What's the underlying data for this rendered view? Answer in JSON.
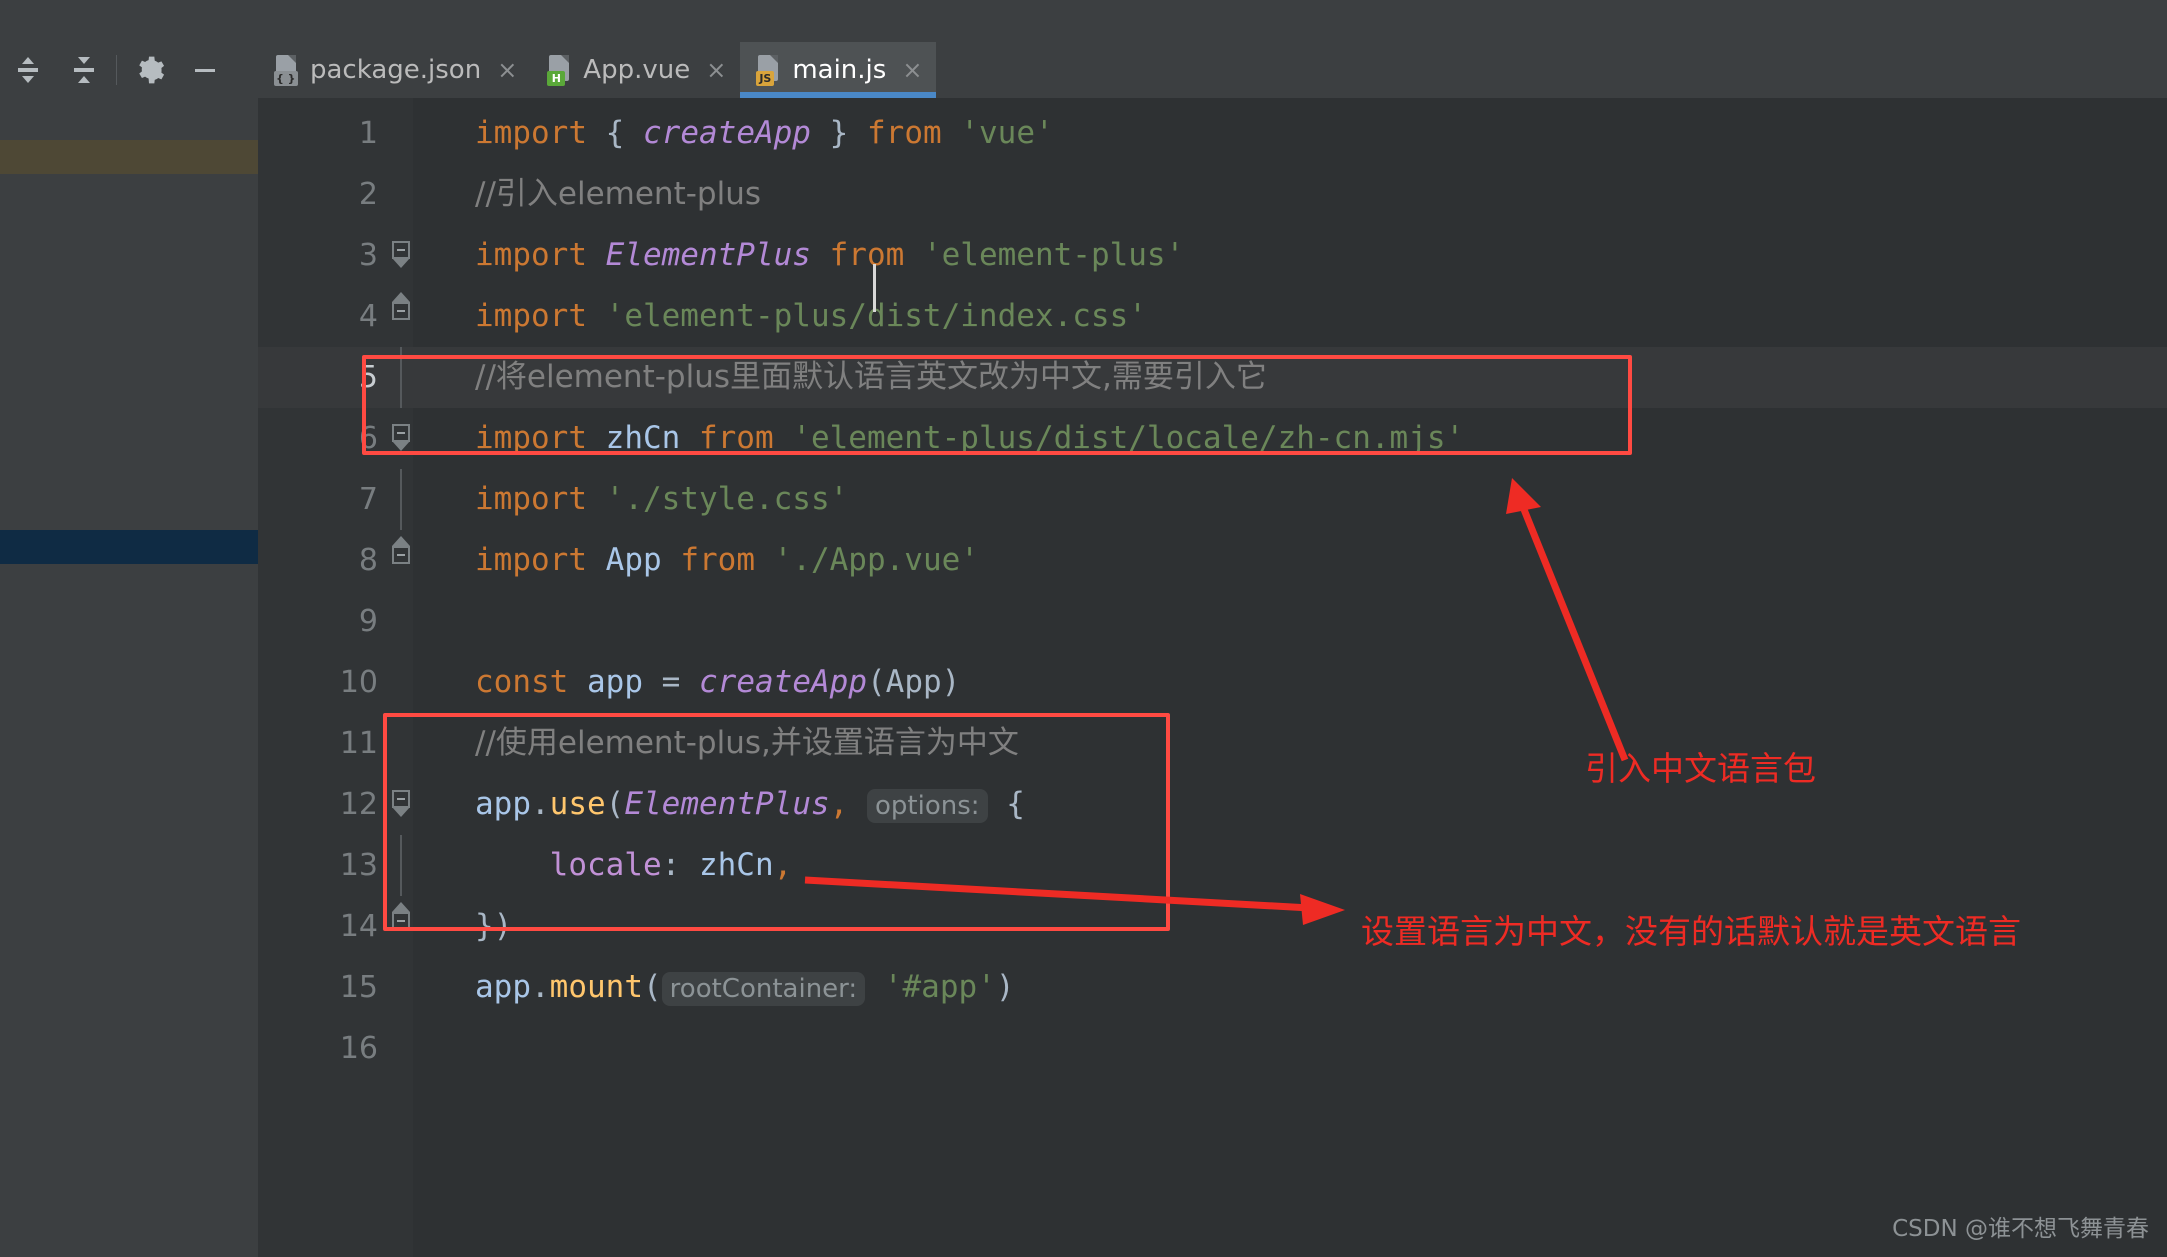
{
  "toolbar": {
    "buttons": [
      {
        "name": "expand-all-icon",
        "label": "Expand All"
      },
      {
        "name": "collapse-all-icon",
        "label": "Collapse All"
      },
      {
        "name": "settings-gear-icon",
        "label": "Settings"
      },
      {
        "name": "hide-icon",
        "label": "Hide"
      }
    ]
  },
  "tabs": [
    {
      "label": "package.json",
      "badge": "{ }",
      "badge_kind": "json",
      "active": false,
      "close": "×"
    },
    {
      "label": "App.vue",
      "badge": "H",
      "badge_kind": "html",
      "active": false,
      "close": "×"
    },
    {
      "label": "main.js",
      "badge": "JS",
      "badge_kind": "js",
      "active": true,
      "close": "×"
    }
  ],
  "editor": {
    "language": "javascript",
    "current_line": 5,
    "lines": [
      {
        "n": "1",
        "tokens": [
          {
            "t": "import",
            "c": "k"
          },
          {
            "t": " ",
            "c": "pun"
          },
          {
            "t": "{",
            "c": "pun"
          },
          {
            "t": " ",
            "c": "pun"
          },
          {
            "t": "createApp",
            "c": "fn"
          },
          {
            "t": " ",
            "c": "pun"
          },
          {
            "t": "}",
            "c": "pun"
          },
          {
            "t": " ",
            "c": "pun"
          },
          {
            "t": "from",
            "c": "k"
          },
          {
            "t": " ",
            "c": "pun"
          },
          {
            "t": "'vue'",
            "c": "str"
          }
        ]
      },
      {
        "n": "2",
        "tokens": [
          {
            "t": "//引入element-plus",
            "c": "cmt"
          }
        ]
      },
      {
        "n": "3",
        "tokens": [
          {
            "t": "import",
            "c": "k"
          },
          {
            "t": " ",
            "c": "pun"
          },
          {
            "t": "ElementPlus",
            "c": "cls"
          },
          {
            "t": " ",
            "c": "pun"
          },
          {
            "t": "from",
            "c": "k"
          },
          {
            "t": " ",
            "c": "pun"
          },
          {
            "t": "'element-plus'",
            "c": "str"
          }
        ]
      },
      {
        "n": "4",
        "tokens": [
          {
            "t": "import",
            "c": "k"
          },
          {
            "t": " ",
            "c": "pun"
          },
          {
            "t": "'element-plus/dist/index.css'",
            "c": "str"
          }
        ]
      },
      {
        "n": "5",
        "tokens": [
          {
            "t": "//将element-plus里面默认语言英文改为中文,需要引入它",
            "c": "cmt"
          }
        ]
      },
      {
        "n": "6",
        "tokens": [
          {
            "t": "import",
            "c": "k"
          },
          {
            "t": " ",
            "c": "pun"
          },
          {
            "t": "zhCn",
            "c": "id"
          },
          {
            "t": " ",
            "c": "pun"
          },
          {
            "t": "from",
            "c": "k"
          },
          {
            "t": " ",
            "c": "pun"
          },
          {
            "t": "'element-plus/dist/locale/zh-cn.mjs'",
            "c": "str"
          }
        ]
      },
      {
        "n": "7",
        "tokens": [
          {
            "t": "import",
            "c": "k"
          },
          {
            "t": " ",
            "c": "pun"
          },
          {
            "t": "'./style.css'",
            "c": "str"
          }
        ]
      },
      {
        "n": "8",
        "tokens": [
          {
            "t": "import",
            "c": "k"
          },
          {
            "t": " ",
            "c": "pun"
          },
          {
            "t": "App",
            "c": "id"
          },
          {
            "t": " ",
            "c": "pun"
          },
          {
            "t": "from",
            "c": "k"
          },
          {
            "t": " ",
            "c": "pun"
          },
          {
            "t": "'./App.vue'",
            "c": "str"
          }
        ]
      },
      {
        "n": "9",
        "tokens": []
      },
      {
        "n": "10",
        "tokens": [
          {
            "t": "const",
            "c": "k"
          },
          {
            "t": " ",
            "c": "pun"
          },
          {
            "t": "app",
            "c": "id"
          },
          {
            "t": " ",
            "c": "pun"
          },
          {
            "t": "=",
            "c": "pun"
          },
          {
            "t": " ",
            "c": "pun"
          },
          {
            "t": "createApp",
            "c": "fn"
          },
          {
            "t": "(",
            "c": "pun"
          },
          {
            "t": "App",
            "c": "pun"
          },
          {
            "t": ")",
            "c": "pun"
          }
        ]
      },
      {
        "n": "11",
        "tokens": [
          {
            "t": "//使用element-plus,并设置语言为中文",
            "c": "cmt"
          }
        ]
      },
      {
        "n": "12",
        "tokens": [
          {
            "t": "app",
            "c": "id"
          },
          {
            "t": ".",
            "c": "pun"
          },
          {
            "t": "use",
            "c": "mth"
          },
          {
            "t": "(",
            "c": "pun"
          },
          {
            "t": "ElementPlus",
            "c": "cls"
          },
          {
            "t": ",",
            "c": "k"
          },
          {
            "t": " ",
            "c": "pun"
          },
          {
            "t": "options:",
            "c": "hint"
          },
          {
            "t": " ",
            "c": "pun"
          },
          {
            "t": "{",
            "c": "pun"
          }
        ]
      },
      {
        "n": "13",
        "tokens": [
          {
            "t": "    ",
            "c": "pun"
          },
          {
            "t": "locale",
            "c": "prop"
          },
          {
            "t": ":",
            "c": "pun"
          },
          {
            "t": " ",
            "c": "pun"
          },
          {
            "t": "zhCn",
            "c": "id"
          },
          {
            "t": ",",
            "c": "k"
          }
        ]
      },
      {
        "n": "14",
        "tokens": [
          {
            "t": "}",
            "c": "pun"
          },
          {
            "t": ")",
            "c": "pun"
          }
        ]
      },
      {
        "n": "15",
        "tokens": [
          {
            "t": "app",
            "c": "id"
          },
          {
            "t": ".",
            "c": "pun"
          },
          {
            "t": "mount",
            "c": "mth"
          },
          {
            "t": "(",
            "c": "pun"
          },
          {
            "t": "rootContainer:",
            "c": "hint"
          },
          {
            "t": " ",
            "c": "pun"
          },
          {
            "t": "'#app'",
            "c": "str"
          },
          {
            "t": ")",
            "c": "pun"
          }
        ]
      },
      {
        "n": "16",
        "tokens": []
      }
    ]
  },
  "annotations": [
    {
      "id": "note-import-locale",
      "text": "引入中文语言包"
    },
    {
      "id": "note-set-locale",
      "text": "设置语言为中文，没有的话默认就是英文语言"
    }
  ],
  "watermark": "CSDN @谁不想飞舞青春",
  "colors": {
    "accent_red": "#ee2b24",
    "box_red": "#ff4a42",
    "tab_active_underline": "#4a88c7",
    "editor_bg": "#2e3133",
    "gutter_bg": "#313436",
    "chrome_bg": "#3c3f41",
    "marker_yellow": "#4e4835",
    "marker_blue": "#0f2b44"
  }
}
